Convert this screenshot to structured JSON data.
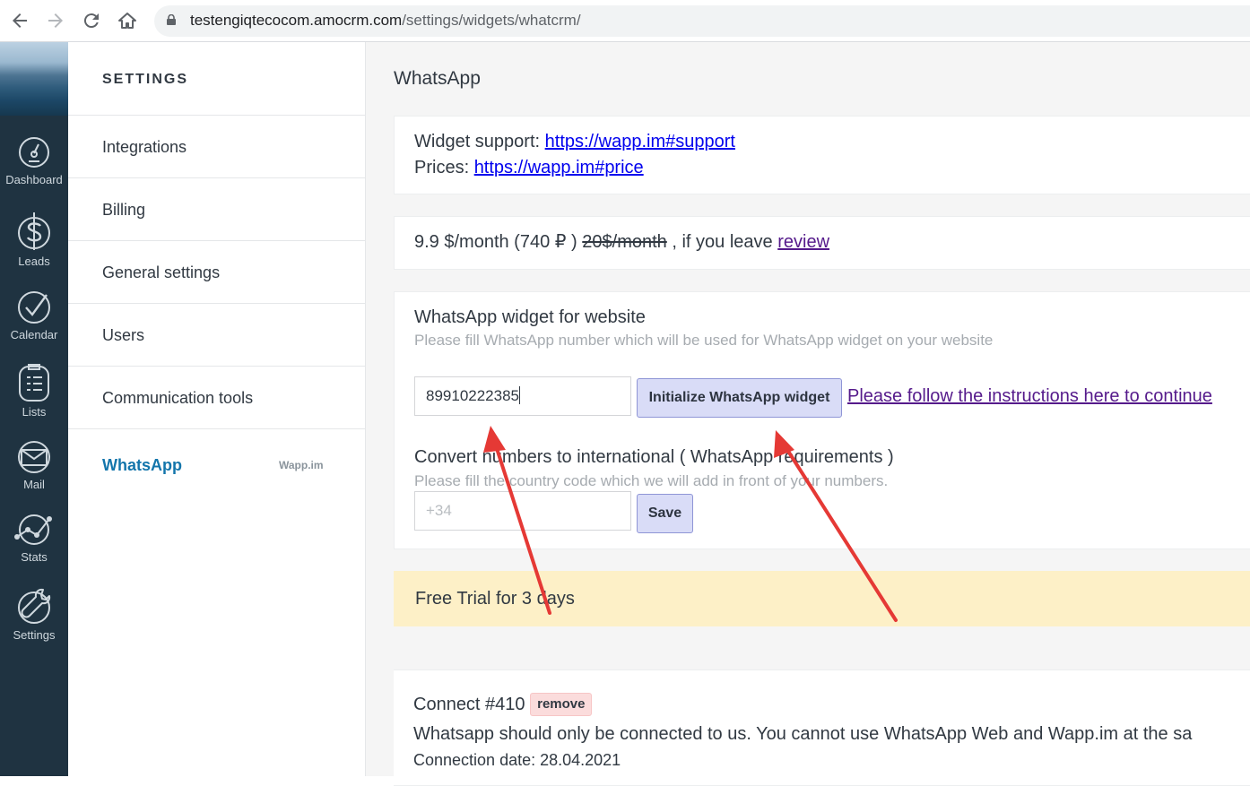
{
  "browser": {
    "url_host": "testengiqtecocom.amocrm.com",
    "url_path": "/settings/widgets/whatcrm/"
  },
  "leftnav": {
    "items": [
      {
        "label": "Dashboard",
        "icon": "dashboard-gauge-icon"
      },
      {
        "label": "Leads",
        "icon": "dollar-icon"
      },
      {
        "label": "Calendar",
        "icon": "check-circle-icon"
      },
      {
        "label": "Lists",
        "icon": "list-clipboard-icon"
      },
      {
        "label": "Mail",
        "icon": "mail-icon"
      },
      {
        "label": "Stats",
        "icon": "stats-graph-icon"
      },
      {
        "label": "Settings",
        "icon": "wrench-icon"
      }
    ]
  },
  "settings": {
    "title": "SETTINGS",
    "items": [
      {
        "label": "Integrations"
      },
      {
        "label": "Billing"
      },
      {
        "label": "General settings"
      },
      {
        "label": "Users"
      },
      {
        "label": "Communication tools"
      },
      {
        "label": "WhatsApp",
        "tag": "Wapp.im"
      }
    ]
  },
  "main": {
    "title": "WhatsApp",
    "support": {
      "support_label": "Widget support:",
      "support_link": "https://wapp.im#support",
      "prices_label": "Prices:",
      "prices_link": "https://wapp.im#price"
    },
    "pricing": {
      "price": "9.9 $/month (740 ₽ )",
      "old_price": "20$/month",
      "suffix": ", if you leave",
      "review_link": "review"
    },
    "widget": {
      "title": "WhatsApp widget for website",
      "hint": "Please fill WhatsApp number which will be used for WhatsApp widget on your website",
      "phone_value": "89910222385",
      "init_button": "Initialize WhatsApp widget",
      "instructions_link": "Please follow the instructions here to continue",
      "convert_title": "Convert numbers to international ( WhatsApp requirements )",
      "convert_hint": "Please fill the country code which we will add in front of your numbers.",
      "country_placeholder": "+34",
      "save_button": "Save"
    },
    "trial": "Free Trial for 3 days",
    "connect": {
      "title": "Connect #410",
      "remove": "remove",
      "warning": "Whatsapp should only be connected to us. You cannot use WhatsApp Web and Wapp.im at the sa",
      "date": "Connection date: 28.04.2021"
    }
  },
  "colors": {
    "sidebar_bg": "#1f3341",
    "active_link": "#1375ab",
    "trial_bg": "#fdf0c7",
    "button_bg": "#d9dcf7",
    "arrow": "#e53935"
  }
}
